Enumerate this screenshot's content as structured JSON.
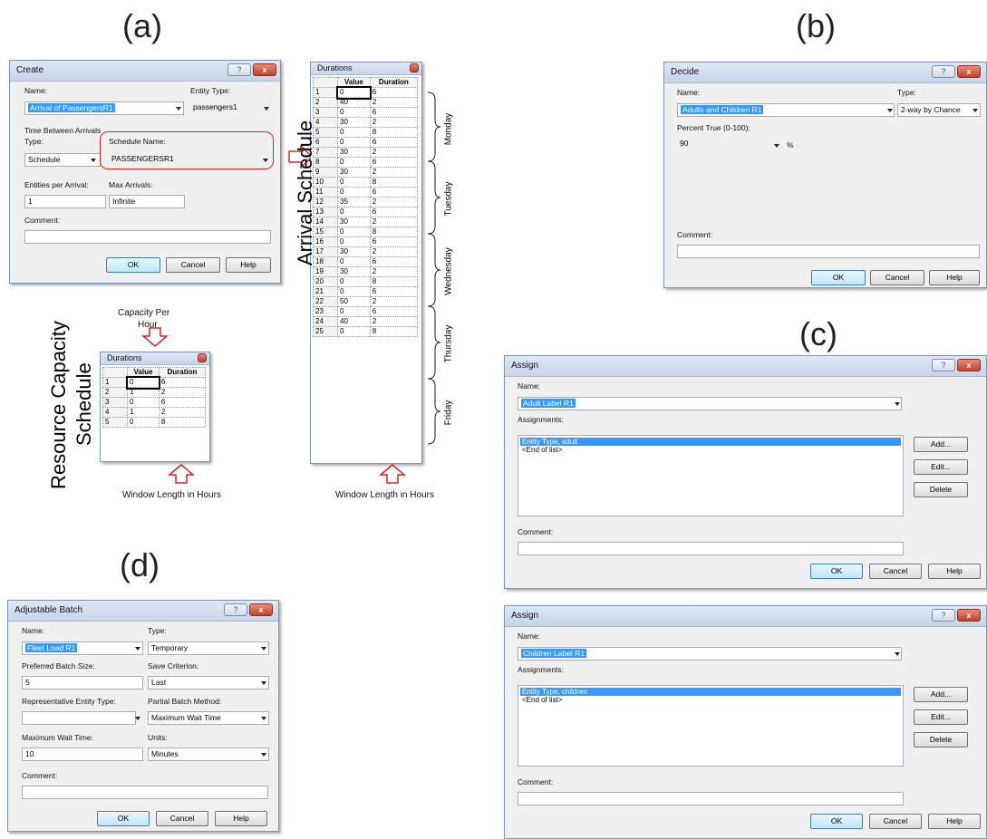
{
  "panels": {
    "a": "(a)",
    "b": "(b)",
    "c": "(c)",
    "d": "(d)"
  },
  "create": {
    "title": "Create",
    "name_label": "Name:",
    "name_value": "Arrival of PassengersR1",
    "entity_type_label": "Entity Type:",
    "entity_type_value": "passengers1",
    "time_between_label": "Time Between Arrivals",
    "type_label": "Type:",
    "type_value": "Schedule",
    "schedule_name_label": "Schedule Name:",
    "schedule_name_value": "PASSENGERSR1",
    "entities_per_arrival_label": "Entities per Arrival:",
    "entities_per_arrival_value": "1",
    "max_arrivals_label": "Max Arrivals:",
    "max_arrivals_value": "Infinite",
    "comment_label": "Comment:",
    "ok": "OK",
    "cancel": "Cancel",
    "help": "Help"
  },
  "arrival_table": {
    "title": "Durations",
    "headers": [
      "",
      "Value",
      "Duration"
    ],
    "rows": [
      [
        "1",
        "0",
        "6"
      ],
      [
        "2",
        "40",
        "2"
      ],
      [
        "3",
        "0",
        "6"
      ],
      [
        "4",
        "30",
        "2"
      ],
      [
        "5",
        "0",
        "8"
      ],
      [
        "6",
        "0",
        "6"
      ],
      [
        "7",
        "30",
        "2"
      ],
      [
        "8",
        "0",
        "6"
      ],
      [
        "9",
        "30",
        "2"
      ],
      [
        "10",
        "0",
        "8"
      ],
      [
        "11",
        "0",
        "6"
      ],
      [
        "12",
        "35",
        "2"
      ],
      [
        "13",
        "0",
        "6"
      ],
      [
        "14",
        "30",
        "2"
      ],
      [
        "15",
        "0",
        "8"
      ],
      [
        "16",
        "0",
        "6"
      ],
      [
        "17",
        "30",
        "2"
      ],
      [
        "18",
        "0",
        "6"
      ],
      [
        "19",
        "30",
        "2"
      ],
      [
        "20",
        "0",
        "8"
      ],
      [
        "21",
        "0",
        "6"
      ],
      [
        "22",
        "50",
        "2"
      ],
      [
        "23",
        "0",
        "6"
      ],
      [
        "24",
        "40",
        "2"
      ],
      [
        "25",
        "0",
        "8"
      ]
    ],
    "side_label": "Arrival Schedule",
    "days": [
      "Monday",
      "Tuesday",
      "Wednesday",
      "Thursday",
      "Friday"
    ],
    "bottom_note": "Window Length in Hours"
  },
  "resource_table": {
    "title": "Durations",
    "headers": [
      "",
      "Value",
      "Duration"
    ],
    "rows": [
      [
        "1",
        "0",
        "6"
      ],
      [
        "2",
        "1",
        "2"
      ],
      [
        "3",
        "0",
        "6"
      ],
      [
        "4",
        "1",
        "2"
      ],
      [
        "5",
        "0",
        "8"
      ]
    ],
    "side_label_1": "Resource Capacity",
    "side_label_2": "Schedule",
    "top_note_1": "Capacity Per",
    "top_note_2": "Hour",
    "bottom_note": "Window Length in Hours"
  },
  "decide": {
    "title": "Decide",
    "name_label": "Name:",
    "name_value": "Adults and Children R1",
    "type_label": "Type:",
    "type_value": "2-way by Chance",
    "percent_label": "Percent True (0-100):",
    "percent_value": "90",
    "percent_unit": "%",
    "comment_label": "Comment:",
    "ok": "OK",
    "cancel": "Cancel",
    "help": "Help"
  },
  "assign1": {
    "title": "Assign",
    "name_label": "Name:",
    "name_value": "Adult Label R1",
    "assignments_label": "Assignments:",
    "items": [
      "Entity Type, adult",
      "<End of list>"
    ],
    "add": "Add...",
    "edit": "Edit...",
    "delete": "Delete",
    "comment_label": "Comment:",
    "ok": "OK",
    "cancel": "Cancel",
    "help": "Help"
  },
  "assign2": {
    "title": "Assign",
    "name_label": "Name:",
    "name_value": "Children Label R1",
    "assignments_label": "Assignments:",
    "items": [
      "Entity Type, children",
      "<End of list>"
    ],
    "add": "Add...",
    "edit": "Edit...",
    "delete": "Delete",
    "comment_label": "Comment:",
    "ok": "OK",
    "cancel": "Cancel",
    "help": "Help"
  },
  "batch": {
    "title": "Adjustable Batch",
    "name_label": "Name:",
    "name_value": "Fleet Load R1",
    "type_label": "Type:",
    "type_value": "Temporary",
    "batch_size_label": "Preferred Batch Size:",
    "batch_size_value": "5",
    "save_label": "Save Criterion:",
    "save_value": "Last",
    "rep_label": "Representative Entity Type:",
    "rep_value": "",
    "partial_label": "Partial Batch Method:",
    "partial_value": "Maximum Wait Time",
    "max_wait_label": "Maximum Wait Time:",
    "max_wait_value": "10",
    "units_label": "Units:",
    "units_value": "Minutes",
    "comment_label": "Comment:",
    "ok": "OK",
    "cancel": "Cancel",
    "help": "Help"
  },
  "icons": {
    "help": "?",
    "close": "x"
  }
}
